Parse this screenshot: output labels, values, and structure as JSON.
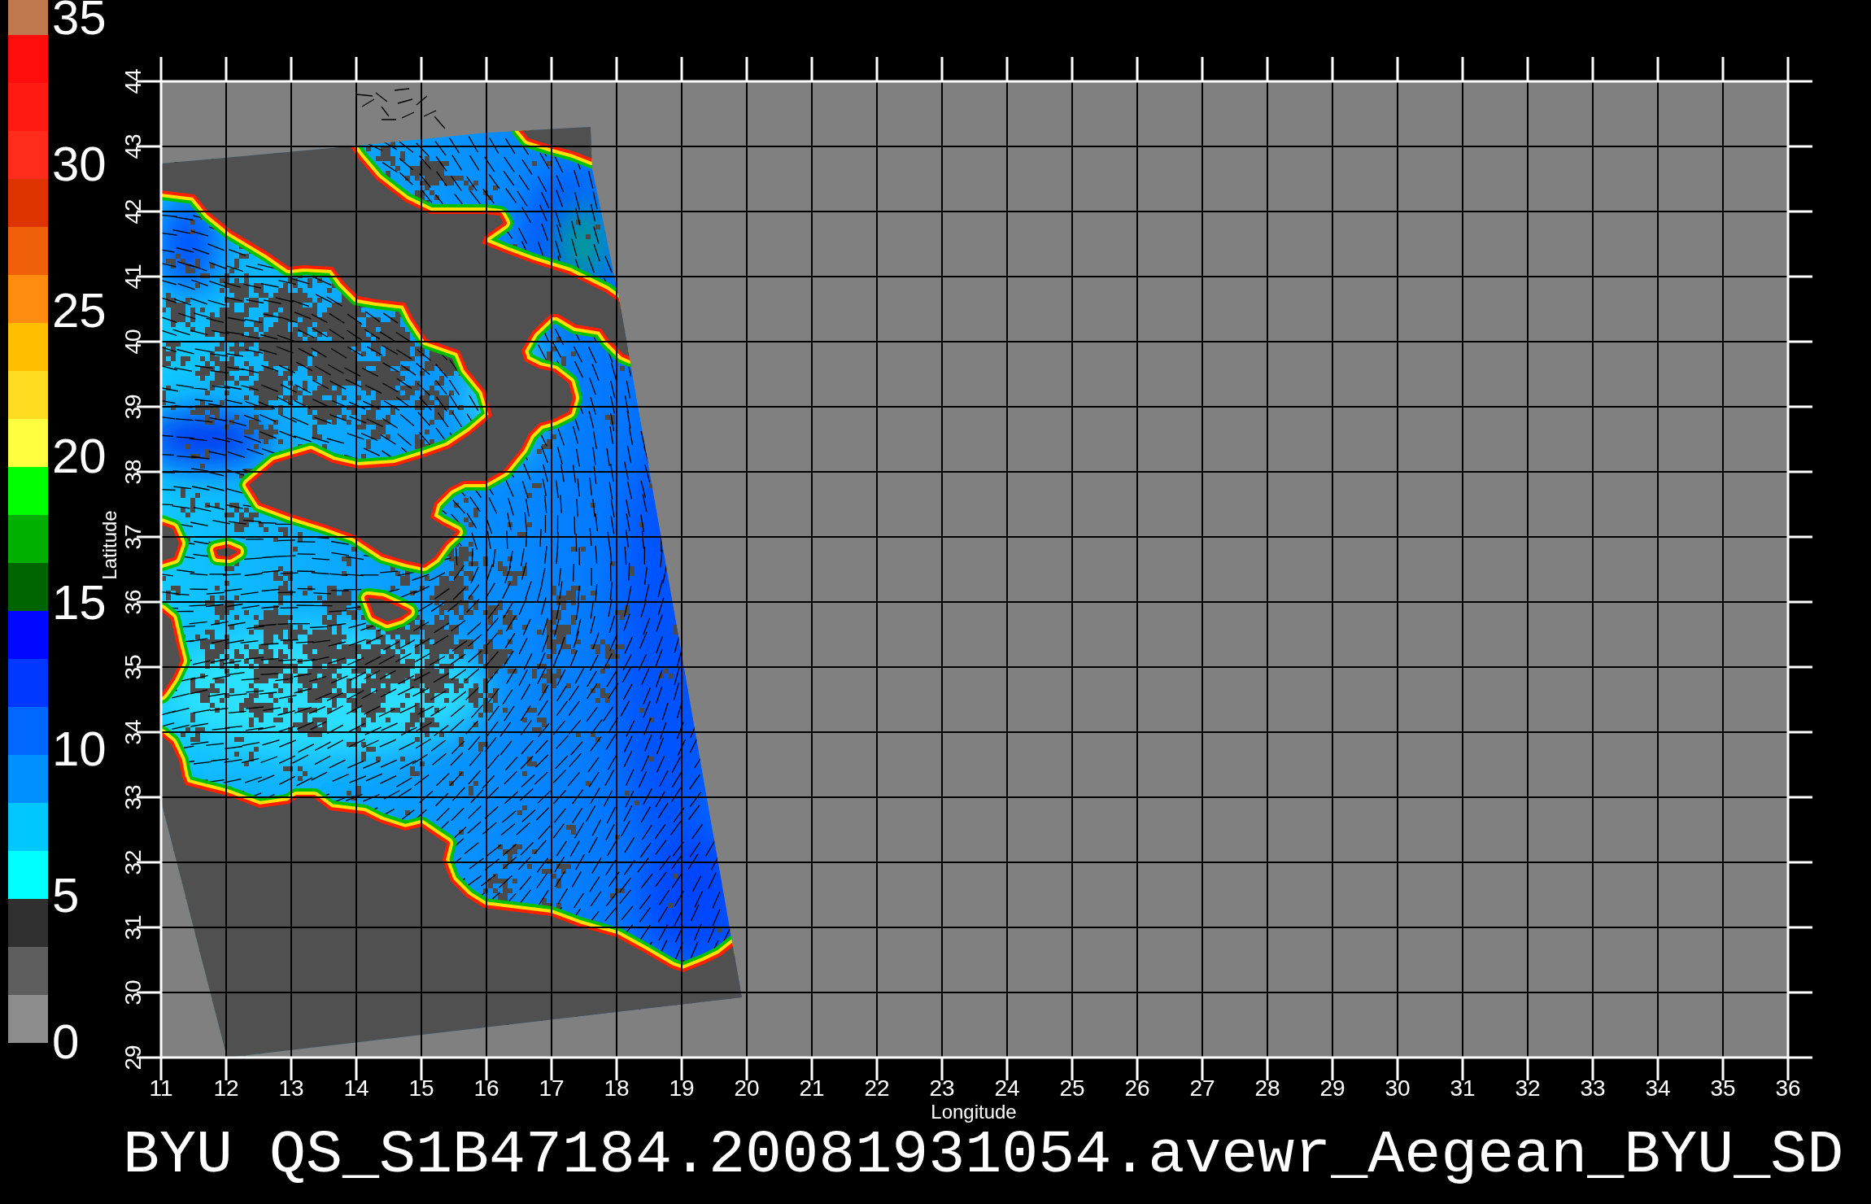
{
  "colorbar": {
    "bands": [
      {
        "color": "#c0784f"
      },
      {
        "color": "#ff0c0c"
      },
      {
        "color": "#ff1a12"
      },
      {
        "color": "#ff2c1c"
      },
      {
        "color": "#e03400"
      },
      {
        "color": "#f06008"
      },
      {
        "color": "#ff8c10"
      },
      {
        "color": "#ffbf00"
      },
      {
        "color": "#ffdc20"
      },
      {
        "color": "#ffff40"
      },
      {
        "color": "#00ff00"
      },
      {
        "color": "#00b000"
      },
      {
        "color": "#006400"
      },
      {
        "color": "#0008ff"
      },
      {
        "color": "#0038ff"
      },
      {
        "color": "#0068ff"
      },
      {
        "color": "#0090ff"
      },
      {
        "color": "#00c8ff"
      },
      {
        "color": "#00ffff"
      },
      {
        "color": "#303030"
      },
      {
        "color": "#5e5e5e"
      },
      {
        "color": "#8c8c8c"
      }
    ],
    "labels": [
      "35",
      "30",
      "25",
      "20",
      "15",
      "10",
      "5",
      "0"
    ]
  },
  "map": {
    "x_axis": {
      "label": "Longitude",
      "ticks": [
        "11",
        "12",
        "13",
        "14",
        "15",
        "16",
        "17",
        "18",
        "19",
        "20",
        "21",
        "22",
        "23",
        "24",
        "25",
        "26",
        "27",
        "28",
        "29",
        "30",
        "31",
        "32",
        "33",
        "34",
        "35",
        "36"
      ]
    },
    "y_axis": {
      "label": "Latitude",
      "ticks": [
        "44",
        "43",
        "42",
        "41",
        "40",
        "39",
        "38",
        "37",
        "36",
        "35",
        "34",
        "33",
        "32",
        "31",
        "30",
        "29"
      ]
    }
  },
  "title": "BYU QS_S1B47184.20081931054.avewr_Aegean_BYU_SD"
}
